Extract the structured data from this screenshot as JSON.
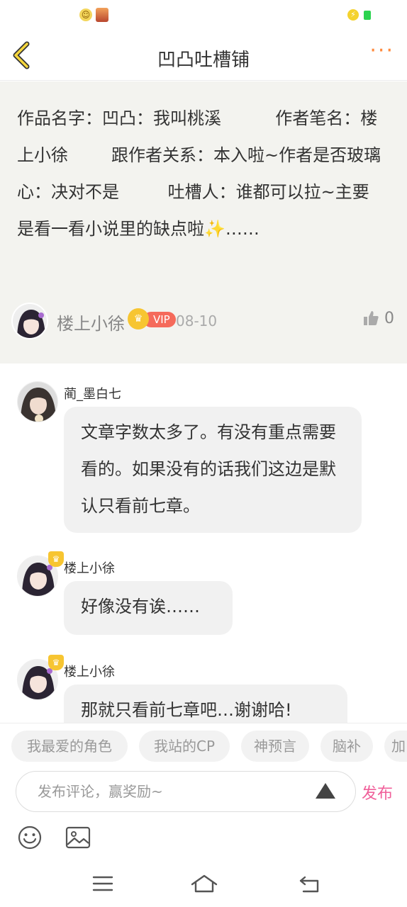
{
  "status": {
    "notif_icon": "smiley-notification-icon",
    "app_icon": "game-app-icon",
    "charging_icon": "charging-icon",
    "battery_color": "#2bd34f"
  },
  "header": {
    "title": "凹凸吐槽铺",
    "back_icon": "chevron-left-icon",
    "more_icon": "more-dots-icon",
    "accent": "#ff8a3d"
  },
  "post": {
    "text": "作品名字：凹凸：我叫桃溪          作者笔名：楼上小徐        跟作者关系：本入啦~作者是否玻璃心：决对不是         吐槽人：谁都可以拉~主要是看一看小说里的缺点啦✨……",
    "author": "楼上小徐",
    "vip": "VIP",
    "date": "08-10",
    "likes": "0"
  },
  "comments": [
    {
      "user": "蔺_墨白七",
      "text": "文章字数太多了。有没有重点需要看的。如果没有的话我们这边是默认只看前七章。"
    },
    {
      "user": "楼上小徐",
      "text": "好像没有诶……"
    },
    {
      "user": "楼上小徐",
      "text": "那就只看前七章吧…谢谢哈!"
    }
  ],
  "tags": [
    "我最爱的角色",
    "我站的CP",
    "神预言",
    "脑补",
    "加"
  ],
  "input": {
    "placeholder": "发布评论，赢奖励~",
    "value": ""
  },
  "publish_label": "发布",
  "publish_color": "#f0609a",
  "tools": [
    "emoji-icon",
    "image-icon"
  ],
  "system_nav": [
    "menu-icon",
    "home-icon",
    "back-icon"
  ]
}
